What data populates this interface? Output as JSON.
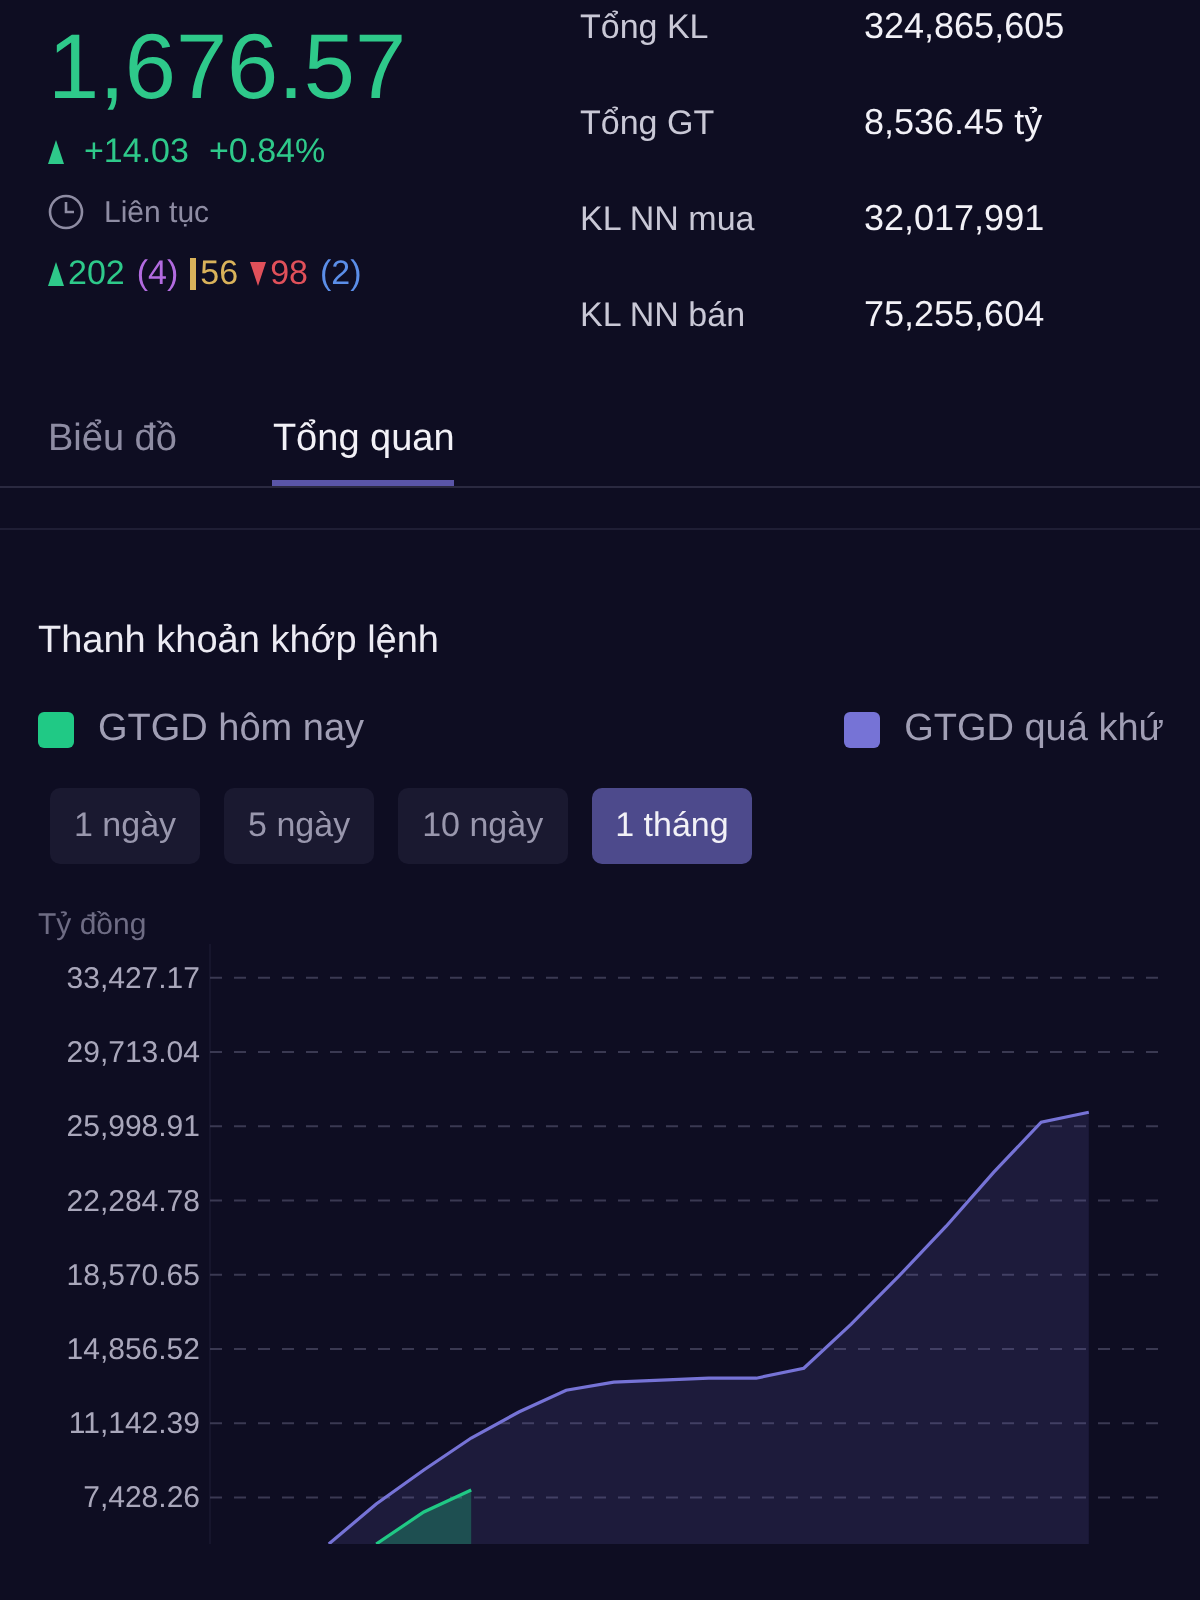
{
  "index": {
    "value": "1,676.57",
    "change": "+14.03",
    "percent": "+0.84%",
    "session": "Liên tục",
    "breadth": [
      {
        "kind": "up",
        "text": "202",
        "color": "#2ec98a"
      },
      {
        "kind": "plain",
        "text": "(4)",
        "color": "#b26be0"
      },
      {
        "kind": "flat",
        "text": "56",
        "color": "#d9b25a"
      },
      {
        "kind": "down",
        "text": "98",
        "color": "#e0505a"
      },
      {
        "kind": "plain",
        "text": "(2)",
        "color": "#5b8ee8"
      }
    ]
  },
  "stats": [
    {
      "label": "Tổng KL",
      "value": "324,865,605"
    },
    {
      "label": "Tổng GT",
      "value": "8,536.45 tỷ"
    },
    {
      "label": "KL NN mua",
      "value": "32,017,991"
    },
    {
      "label": "KL NN bán",
      "value": "75,255,604"
    }
  ],
  "tabs": [
    {
      "label": "Biểu đồ",
      "selected": false
    },
    {
      "label": "Tổng quan",
      "selected": true
    }
  ],
  "section": {
    "title": "Thanh khoản khớp lệnh",
    "periods": [
      {
        "label": "1 ngày",
        "selected": false
      },
      {
        "label": "5 ngày",
        "selected": false
      },
      {
        "label": "10 ngày",
        "selected": false
      },
      {
        "label": "1 tháng",
        "selected": true
      }
    ],
    "chart_data": {
      "type": "area",
      "ylabel": "Tỷ đồng",
      "categories": [
        null,
        null,
        null,
        null,
        null,
        null,
        null,
        null,
        null,
        null,
        null,
        null,
        null,
        null,
        null,
        null,
        null,
        null,
        null,
        null
      ],
      "ylim": [
        5100,
        35120
      ],
      "grid": true,
      "yticks": [
        {
          "value": 33427.17,
          "label": "33,427.17"
        },
        {
          "value": 29713.04,
          "label": "29,713.04"
        },
        {
          "value": 25998.91,
          "label": "25,998.91"
        },
        {
          "value": 22284.78,
          "label": "22,284.78"
        },
        {
          "value": 18570.65,
          "label": "18,570.65"
        },
        {
          "value": 14856.52,
          "label": "14,856.52"
        },
        {
          "value": 11142.39,
          "label": "11,142.39"
        },
        {
          "value": 7428.26,
          "label": "7,428.26"
        }
      ],
      "series": [
        {
          "name": "GTGD hôm nay",
          "color": "#20c985",
          "values": [
            null,
            null,
            null,
            5100,
            6700,
            7800,
            null,
            null,
            null,
            null,
            null,
            null,
            null,
            null,
            null,
            null,
            null,
            null,
            null,
            null
          ]
        },
        {
          "name": "GTGD quá khứ",
          "color": "#7673d6",
          "values": [
            null,
            null,
            5100,
            7100,
            8800,
            10400,
            11700,
            12800,
            13200,
            13300,
            13400,
            13400,
            13900,
            16100,
            18500,
            21000,
            23700,
            26200,
            26700,
            null
          ]
        }
      ]
    }
  }
}
